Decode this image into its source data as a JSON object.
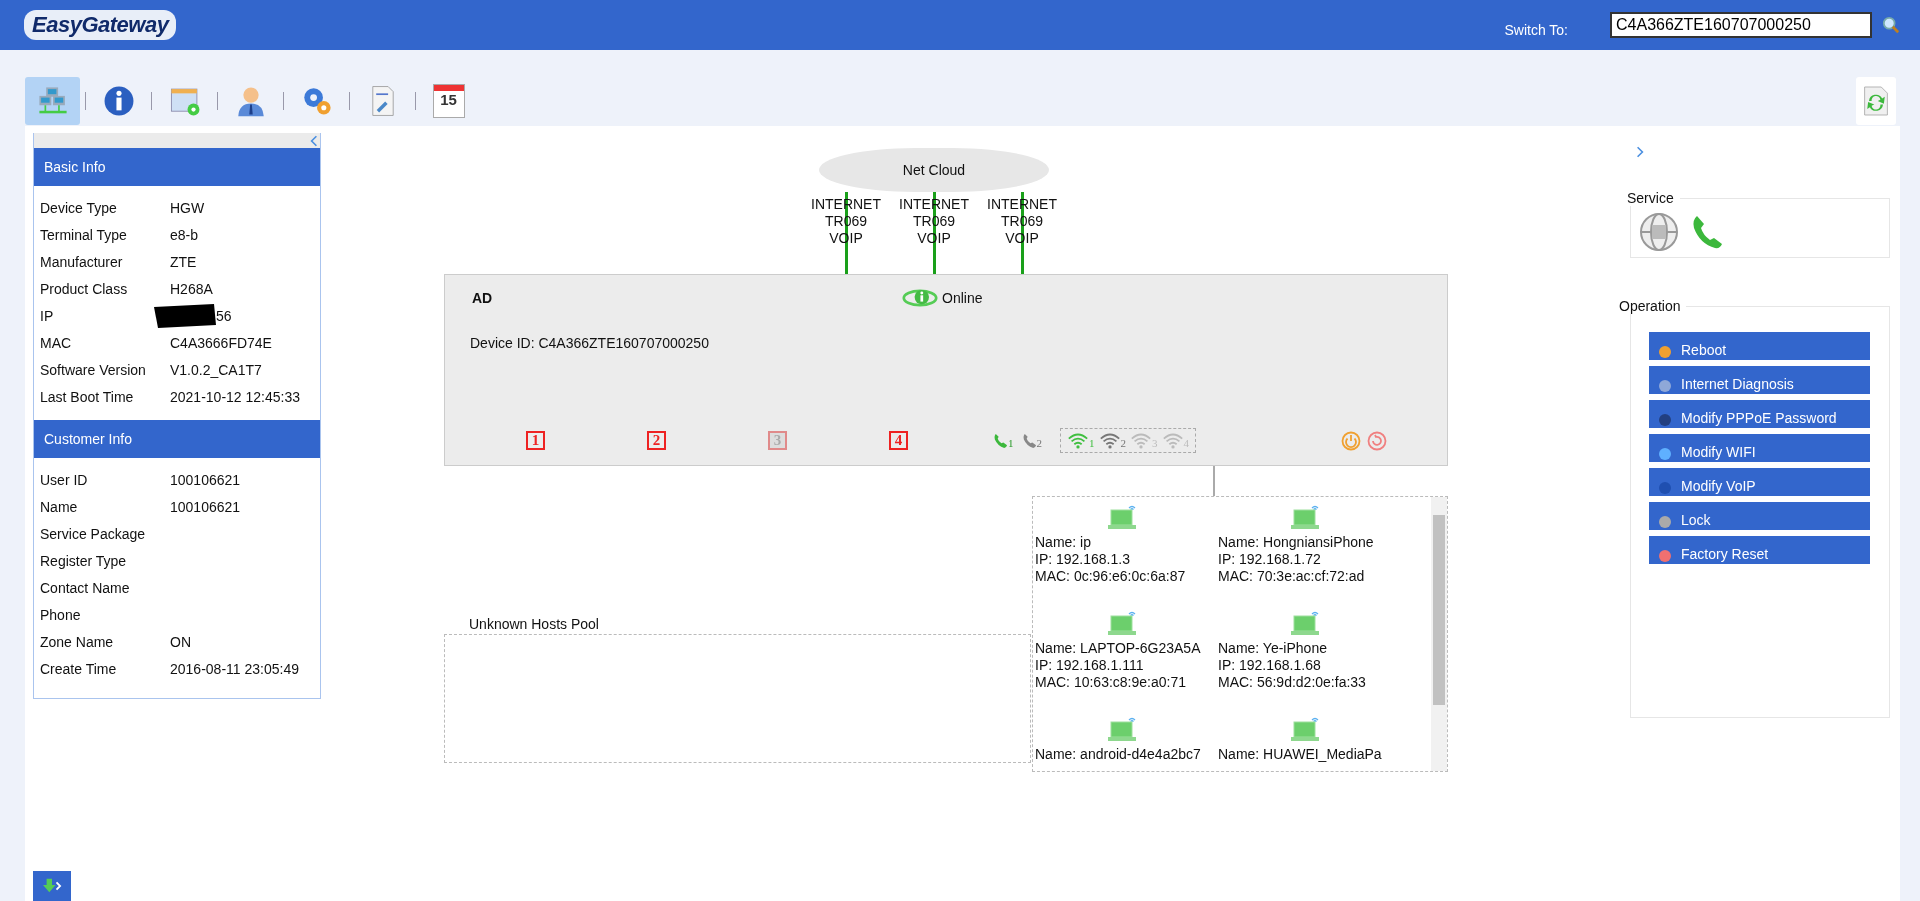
{
  "header": {
    "logo": "EasyGateway",
    "switch_label": "Switch To:",
    "switch_field": {
      "value": "C4A366ZTE160707000250"
    }
  },
  "toolbar": [
    {
      "kind": "network",
      "selected": true
    },
    {
      "kind": "info",
      "selected": false
    },
    {
      "kind": "calendar-gear",
      "selected": false
    },
    {
      "kind": "user",
      "selected": false
    },
    {
      "kind": "gears",
      "selected": false
    },
    {
      "kind": "doc-wrench",
      "selected": false
    },
    {
      "kind": "calendar-date",
      "selected": false,
      "text": "15"
    }
  ],
  "left_panel": {
    "sections": [
      {
        "title": "Basic Info",
        "rows": [
          {
            "label": "Device Type",
            "value": "HGW"
          },
          {
            "label": "Terminal Type",
            "value": "e8-b"
          },
          {
            "label": "Manufacturer",
            "value": "ZTE"
          },
          {
            "label": "Product Class",
            "value": "H268A"
          },
          {
            "label": "IP",
            "value": "56",
            "redacted": true
          },
          {
            "label": "MAC",
            "value": "C4A3666FD74E"
          },
          {
            "label": "Software Version",
            "value": "V1.0.2_CA1T7"
          },
          {
            "label": "Last Boot Time",
            "value": "2021-10-12 12:45:33"
          }
        ]
      },
      {
        "title": "Customer Info",
        "rows": [
          {
            "label": "User ID",
            "value": "100106621"
          },
          {
            "label": "Name",
            "value": "100106621"
          },
          {
            "label": "Service Package"
          },
          {
            "label": "Register Type"
          },
          {
            "label": "Contact Name"
          },
          {
            "label": "Phone"
          },
          {
            "label": "Zone Name",
            "value": "ON"
          },
          {
            "label": "Create Time",
            "value": "2016-08-11 23:05:49"
          }
        ]
      }
    ]
  },
  "topology": {
    "cloud": "Net Cloud",
    "uplinks": [
      {
        "lines": [
          "INTERNET",
          "TR069",
          "VOIP"
        ]
      },
      {
        "lines": [
          "INTERNET",
          "TR069",
          "VOIP"
        ]
      },
      {
        "lines": [
          "INTERNET",
          "TR069",
          "VOIP"
        ]
      }
    ],
    "device": {
      "name": "AD",
      "status": "Online",
      "device_id": "Device ID: C4A366ZTE160707000250",
      "ports": [
        {
          "label": "1",
          "on": true
        },
        {
          "label": "2",
          "on": true
        },
        {
          "label": "3",
          "on": false
        },
        {
          "label": "4",
          "on": true
        }
      ],
      "phones": [
        {
          "label": "1",
          "on": true
        },
        {
          "label": "2",
          "on": false
        }
      ],
      "wifi": [
        {
          "label": "1",
          "color": "#3fbf3f"
        },
        {
          "label": "2",
          "color": "#777777"
        },
        {
          "label": "3",
          "color": "#bbbbbb"
        },
        {
          "label": "4",
          "color": "#bbbbbb"
        }
      ]
    },
    "unknown_pool": {
      "title": "Unknown Hosts Pool"
    },
    "hosts": [
      {
        "name": "Name: ip",
        "ip": "IP: 192.168.1.3",
        "mac": "MAC: 0c:96:e6:0c:6a:87"
      },
      {
        "name": "Name: HongniansiPhone",
        "ip": "IP: 192.168.1.72",
        "mac": "MAC: 70:3e:ac:cf:72:ad"
      },
      {
        "name": "Name: LAPTOP-6G23A5A",
        "ip": "IP: 192.168.1.111",
        "mac": "MAC: 10:63:c8:9e:a0:71"
      },
      {
        "name": "Name: Ye-iPhone",
        "ip": "IP: 192.168.1.68",
        "mac": "MAC: 56:9d:d2:0e:fa:33"
      },
      {
        "name": "Name: android-d4e4a2bc7"
      },
      {
        "name": "Name: HUAWEI_MediaPa"
      }
    ]
  },
  "right_panel": {
    "service": {
      "title": "Service",
      "items": [
        {
          "kind": "globe"
        },
        {
          "kind": "phone"
        }
      ]
    },
    "operation": {
      "title": "Operation",
      "buttons": [
        {
          "kind": "reboot",
          "label": "Reboot"
        },
        {
          "kind": "diagnosis",
          "label": "Internet Diagnosis"
        },
        {
          "kind": "pppoe",
          "label": "Modify PPPoE Password"
        },
        {
          "kind": "wifi",
          "label": "Modify WIFI"
        },
        {
          "kind": "voip",
          "label": "Modify VoIP"
        },
        {
          "kind": "lock",
          "label": "Lock"
        },
        {
          "kind": "reset",
          "label": "Factory Reset"
        }
      ]
    }
  }
}
